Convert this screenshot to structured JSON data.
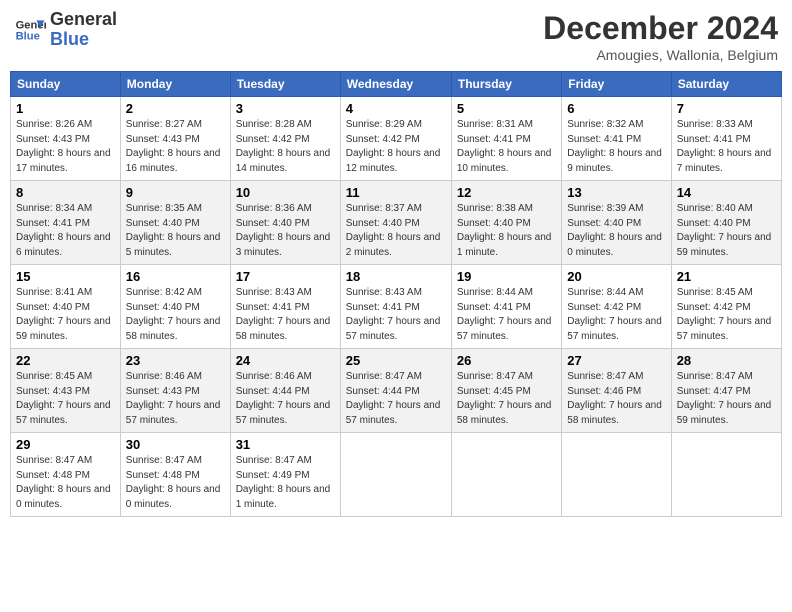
{
  "header": {
    "logo_line1": "General",
    "logo_line2": "Blue",
    "title": "December 2024",
    "subtitle": "Amougies, Wallonia, Belgium"
  },
  "weekdays": [
    "Sunday",
    "Monday",
    "Tuesday",
    "Wednesday",
    "Thursday",
    "Friday",
    "Saturday"
  ],
  "weeks": [
    [
      {
        "day": "1",
        "sunrise": "8:26 AM",
        "sunset": "4:43 PM",
        "daylight": "8 hours and 17 minutes."
      },
      {
        "day": "2",
        "sunrise": "8:27 AM",
        "sunset": "4:43 PM",
        "daylight": "8 hours and 16 minutes."
      },
      {
        "day": "3",
        "sunrise": "8:28 AM",
        "sunset": "4:42 PM",
        "daylight": "8 hours and 14 minutes."
      },
      {
        "day": "4",
        "sunrise": "8:29 AM",
        "sunset": "4:42 PM",
        "daylight": "8 hours and 12 minutes."
      },
      {
        "day": "5",
        "sunrise": "8:31 AM",
        "sunset": "4:41 PM",
        "daylight": "8 hours and 10 minutes."
      },
      {
        "day": "6",
        "sunrise": "8:32 AM",
        "sunset": "4:41 PM",
        "daylight": "8 hours and 9 minutes."
      },
      {
        "day": "7",
        "sunrise": "8:33 AM",
        "sunset": "4:41 PM",
        "daylight": "8 hours and 7 minutes."
      }
    ],
    [
      {
        "day": "8",
        "sunrise": "8:34 AM",
        "sunset": "4:41 PM",
        "daylight": "8 hours and 6 minutes."
      },
      {
        "day": "9",
        "sunrise": "8:35 AM",
        "sunset": "4:40 PM",
        "daylight": "8 hours and 5 minutes."
      },
      {
        "day": "10",
        "sunrise": "8:36 AM",
        "sunset": "4:40 PM",
        "daylight": "8 hours and 3 minutes."
      },
      {
        "day": "11",
        "sunrise": "8:37 AM",
        "sunset": "4:40 PM",
        "daylight": "8 hours and 2 minutes."
      },
      {
        "day": "12",
        "sunrise": "8:38 AM",
        "sunset": "4:40 PM",
        "daylight": "8 hours and 1 minute."
      },
      {
        "day": "13",
        "sunrise": "8:39 AM",
        "sunset": "4:40 PM",
        "daylight": "8 hours and 0 minutes."
      },
      {
        "day": "14",
        "sunrise": "8:40 AM",
        "sunset": "4:40 PM",
        "daylight": "7 hours and 59 minutes."
      }
    ],
    [
      {
        "day": "15",
        "sunrise": "8:41 AM",
        "sunset": "4:40 PM",
        "daylight": "7 hours and 59 minutes."
      },
      {
        "day": "16",
        "sunrise": "8:42 AM",
        "sunset": "4:40 PM",
        "daylight": "7 hours and 58 minutes."
      },
      {
        "day": "17",
        "sunrise": "8:43 AM",
        "sunset": "4:41 PM",
        "daylight": "7 hours and 58 minutes."
      },
      {
        "day": "18",
        "sunrise": "8:43 AM",
        "sunset": "4:41 PM",
        "daylight": "7 hours and 57 minutes."
      },
      {
        "day": "19",
        "sunrise": "8:44 AM",
        "sunset": "4:41 PM",
        "daylight": "7 hours and 57 minutes."
      },
      {
        "day": "20",
        "sunrise": "8:44 AM",
        "sunset": "4:42 PM",
        "daylight": "7 hours and 57 minutes."
      },
      {
        "day": "21",
        "sunrise": "8:45 AM",
        "sunset": "4:42 PM",
        "daylight": "7 hours and 57 minutes."
      }
    ],
    [
      {
        "day": "22",
        "sunrise": "8:45 AM",
        "sunset": "4:43 PM",
        "daylight": "7 hours and 57 minutes."
      },
      {
        "day": "23",
        "sunrise": "8:46 AM",
        "sunset": "4:43 PM",
        "daylight": "7 hours and 57 minutes."
      },
      {
        "day": "24",
        "sunrise": "8:46 AM",
        "sunset": "4:44 PM",
        "daylight": "7 hours and 57 minutes."
      },
      {
        "day": "25",
        "sunrise": "8:47 AM",
        "sunset": "4:44 PM",
        "daylight": "7 hours and 57 minutes."
      },
      {
        "day": "26",
        "sunrise": "8:47 AM",
        "sunset": "4:45 PM",
        "daylight": "7 hours and 58 minutes."
      },
      {
        "day": "27",
        "sunrise": "8:47 AM",
        "sunset": "4:46 PM",
        "daylight": "7 hours and 58 minutes."
      },
      {
        "day": "28",
        "sunrise": "8:47 AM",
        "sunset": "4:47 PM",
        "daylight": "7 hours and 59 minutes."
      }
    ],
    [
      {
        "day": "29",
        "sunrise": "8:47 AM",
        "sunset": "4:48 PM",
        "daylight": "8 hours and 0 minutes."
      },
      {
        "day": "30",
        "sunrise": "8:47 AM",
        "sunset": "4:48 PM",
        "daylight": "8 hours and 0 minutes."
      },
      {
        "day": "31",
        "sunrise": "8:47 AM",
        "sunset": "4:49 PM",
        "daylight": "8 hours and 1 minute."
      },
      null,
      null,
      null,
      null
    ]
  ],
  "labels": {
    "sunrise": "Sunrise:",
    "sunset": "Sunset:",
    "daylight": "Daylight:"
  }
}
